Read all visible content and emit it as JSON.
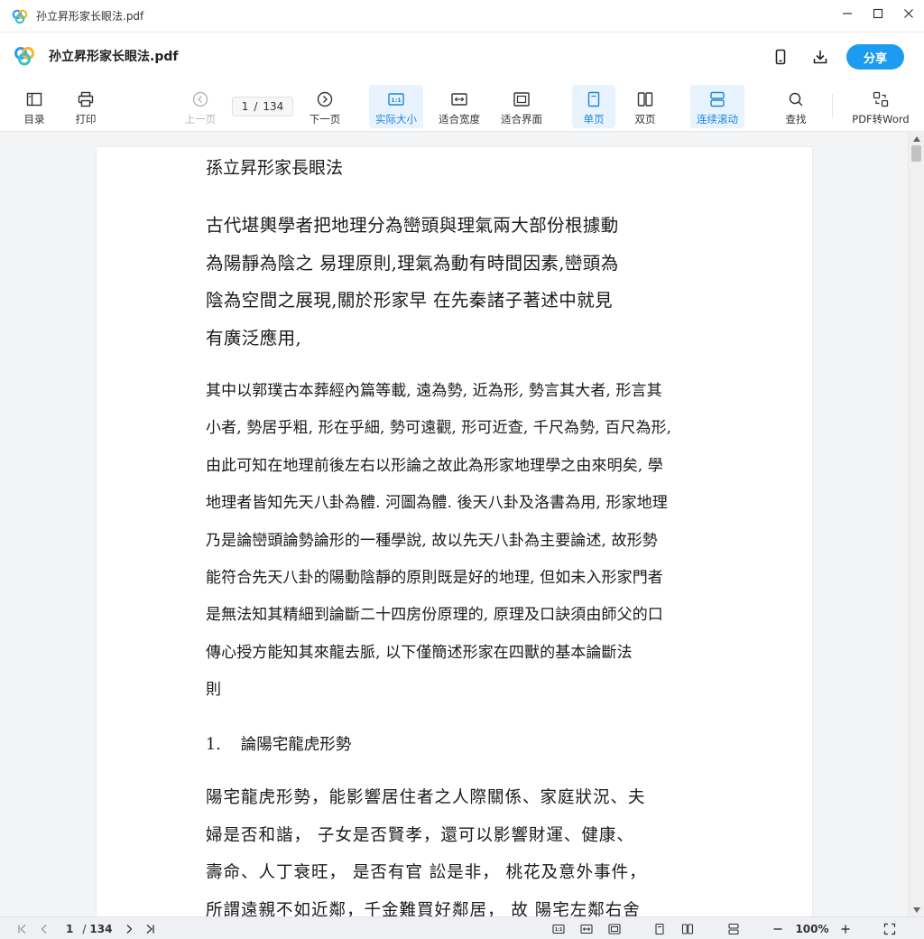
{
  "window": {
    "title": "孙立昇形家长眼法.pdf"
  },
  "header": {
    "doc_title": "孙立昇形家长眼法.pdf",
    "share_label": "分享"
  },
  "toolbar": {
    "toc_label": "目录",
    "print_label": "打印",
    "prev_label": "上一页",
    "current_page": "1",
    "page_sep": "/",
    "total_pages": "134",
    "next_label": "下一页",
    "actual_size_label": "实际大小",
    "fit_width_label": "适合宽度",
    "fit_page_label": "适合界面",
    "single_page_label": "单页",
    "double_page_label": "双页",
    "continuous_label": "连续滚动",
    "search_label": "查找",
    "pdf_to_word_label": "PDF转Word",
    "actual_size_icon_text": "1:1"
  },
  "document": {
    "heading": "孫立昇形家長眼法",
    "para1": [
      "古代堪輿學者把地理分為巒頭與理氣兩大部份根據動",
      "為陽靜為陰之  易理原則,理氣為動有時間因素,巒頭為",
      "陰為空間之展現,關於形家早  在先秦諸子著述中就見",
      "有廣泛應用,"
    ],
    "para2": [
      "其中以郭璞古本葬經內篇等載, 遠為勢, 近為形, 勢言其大者, 形言其",
      "小者, 勢居乎粗, 形在乎細, 勢可遠觀, 形可近查, 千尺為勢, 百尺為形,",
      "由此可知在地理前後左右以形論之故此為形家地理學之由來明矣, 學",
      "地理者皆知先天八卦為體. 河圖為體. 後天八卦及洛書為用, 形家地理",
      "乃是論巒頭論勢論形的一種學說, 故以先天八卦為主要論述, 故形勢",
      "能符合先天八卦的陽動陰靜的原則既是好的地理, 但如未入形家門者",
      "是無法知其精細到論斷二十四房份原理的, 原理及口訣須由師父的口",
      "傳心授方能知其來龍去脈, 以下僅簡述形家在四獸的基本論斷法",
      "則"
    ],
    "section_number": "1.",
    "section_title": "論陽宅龍虎形勢",
    "para3": [
      "陽宅龍虎形勢，能影響居住者之人際關係、家庭狀況、夫",
      "婦是否和諧， 子女是否賢孝，還可以影響財運、健康、",
      "壽命、人丁衰旺， 是否有官 訟是非， 桃花及意外事件，",
      "所謂遠親不如近鄰，千金難買好鄰居， 故 陽宅左鄰右舍"
    ]
  },
  "statusbar": {
    "current_page": "1",
    "page_sep": "/",
    "total_pages": "134",
    "zoom": "100%",
    "actual_size_icon_text": "1:1"
  },
  "colors": {
    "accent": "#1b9cf0",
    "active_bg": "#e8f3fd",
    "active_text": "#1b86e0"
  }
}
